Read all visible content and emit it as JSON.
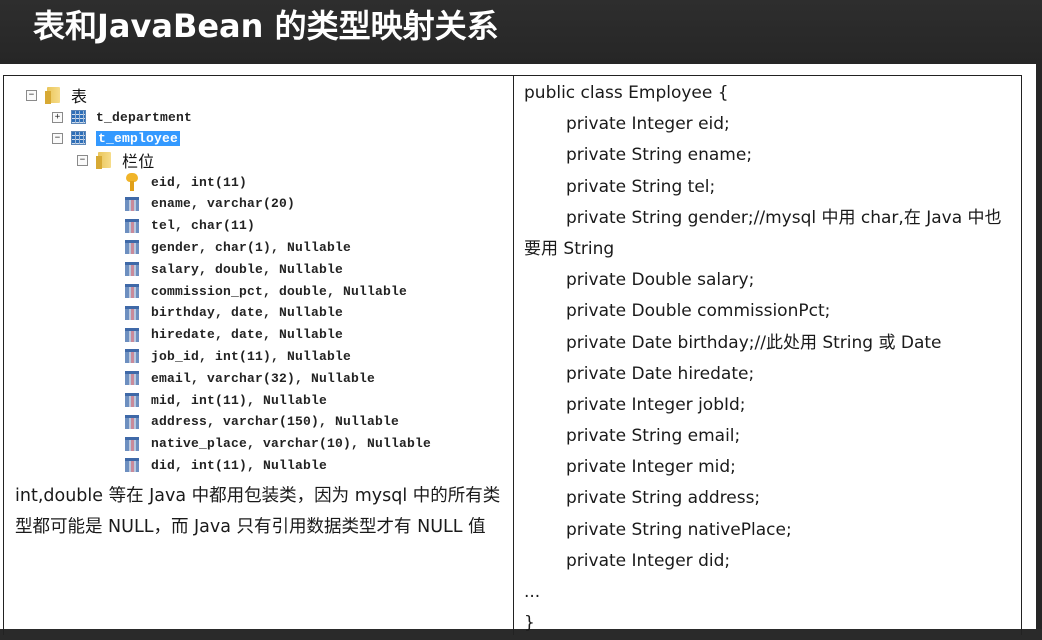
{
  "title": "表和JavaBean 的类型映射关系",
  "tree": {
    "root": {
      "label": "表",
      "toggle": "⊟",
      "icon": "folder-icon"
    },
    "tables": [
      {
        "label": "t_department",
        "toggle": "+",
        "icon": "table-icon",
        "selected": false
      },
      {
        "label": "t_employee",
        "toggle": "−",
        "icon": "table-icon",
        "selected": true
      }
    ],
    "columns_folder": {
      "label": "栏位",
      "toggle": "−",
      "icon": "folder-icon"
    },
    "columns": [
      {
        "label": "eid, int(11)",
        "icon": "primary-key-icon"
      },
      {
        "label": "ename, varchar(20)",
        "icon": "column-icon"
      },
      {
        "label": "tel, char(11)",
        "icon": "column-icon"
      },
      {
        "label": "gender, char(1), Nullable",
        "icon": "column-icon"
      },
      {
        "label": "salary, double, Nullable",
        "icon": "column-icon"
      },
      {
        "label": "commission_pct, double, Nullable",
        "icon": "column-icon"
      },
      {
        "label": "birthday, date, Nullable",
        "icon": "column-icon"
      },
      {
        "label": "hiredate, date, Nullable",
        "icon": "column-icon"
      },
      {
        "label": "job_id, int(11), Nullable",
        "icon": "column-icon"
      },
      {
        "label": "email, varchar(32), Nullable",
        "icon": "column-icon"
      },
      {
        "label": "mid, int(11), Nullable",
        "icon": "column-icon"
      },
      {
        "label": "address, varchar(150), Nullable",
        "icon": "column-icon"
      },
      {
        "label": "native_place, varchar(10), Nullable",
        "icon": "column-icon"
      },
      {
        "label": "did, int(11), Nullable",
        "icon": "column-icon"
      }
    ]
  },
  "note": "int,double 等在 Java 中都用包装类，因为 mysql 中的所有类型都可能是 NULL，而 Java 只有引用数据类型才有 NULL 值",
  "code": {
    "lines": [
      {
        "text": "public class Employee {",
        "indent": false
      },
      {
        "text": "private Integer eid;",
        "indent": true
      },
      {
        "text": "private String ename;",
        "indent": true
      },
      {
        "text": "private String tel;",
        "indent": true
      },
      {
        "text": "private String gender;//mysql 中用 char,在 Java 中也",
        "indent": true
      },
      {
        "text": "要用 String",
        "indent": false
      },
      {
        "text": "private Double salary;",
        "indent": true
      },
      {
        "text": "private Double commissionPct;",
        "indent": true
      },
      {
        "text": "private Date birthday;//此处用 String 或 Date",
        "indent": true
      },
      {
        "text": "private Date hiredate;",
        "indent": true
      },
      {
        "text": "private Integer jobId;",
        "indent": true
      },
      {
        "text": "private String email;",
        "indent": true
      },
      {
        "text": "private Integer mid;",
        "indent": true
      },
      {
        "text": "private String address;",
        "indent": true
      },
      {
        "text": "private String nativePlace;",
        "indent": true
      },
      {
        "text": "private Integer did;",
        "indent": true
      },
      {
        "text": "...",
        "indent": false
      },
      {
        "text": "}",
        "indent": false
      }
    ]
  }
}
